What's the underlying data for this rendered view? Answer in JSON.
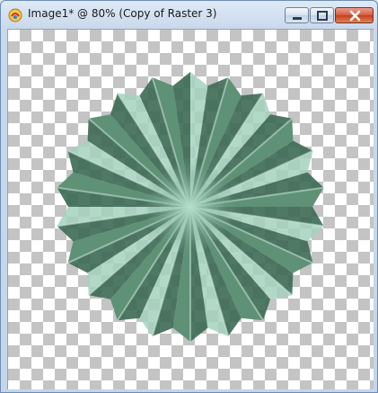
{
  "window": {
    "title": "Image1* @  80% (Copy of Raster 3)",
    "controls": {
      "minimize": "minimize",
      "maximize": "maximize",
      "close": "close"
    }
  },
  "canvas": {
    "content": "pleated-rosette",
    "rosette_color": "#5f9177",
    "highlight_color": "#a4d2be",
    "shadow_color": "#3d6a54",
    "checker_dark": "#c4c4c4",
    "checker_light": "#ffffff",
    "folds": 22
  },
  "icons": {
    "app": "app-icon",
    "minimize": "minimize-icon",
    "maximize": "maximize-icon",
    "close": "close-icon"
  }
}
